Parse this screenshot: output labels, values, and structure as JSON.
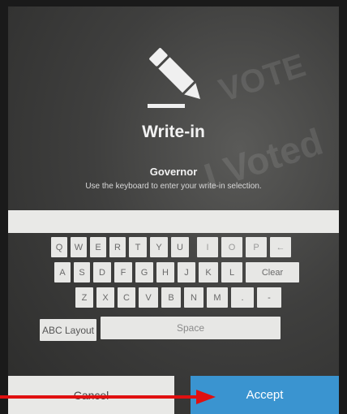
{
  "header": {
    "icon": "pencil-icon",
    "title": "Write-in",
    "contest": "Governor",
    "instructions": "Use the keyboard to enter your write-in selection."
  },
  "background_text": [
    "VOTE",
    "I Voted"
  ],
  "writein": {
    "value": ""
  },
  "keyboard": {
    "row1": [
      "Q",
      "W",
      "E",
      "R",
      "T",
      "Y",
      "U",
      "I",
      "O",
      "P",
      "←"
    ],
    "row2": [
      "A",
      "S",
      "D",
      "F",
      "G",
      "H",
      "J",
      "K",
      "L",
      "Clear"
    ],
    "row3": [
      "Z",
      "X",
      "C",
      "V",
      "B",
      "N",
      "M",
      ".",
      "-"
    ],
    "layout_label": "ABC Layout",
    "space_label": "Space"
  },
  "actions": {
    "cancel": "Cancel",
    "accept": "Accept"
  },
  "colors": {
    "accept": "#3a94d0",
    "arrow": "#e01010",
    "key": "#e7e7e5"
  }
}
